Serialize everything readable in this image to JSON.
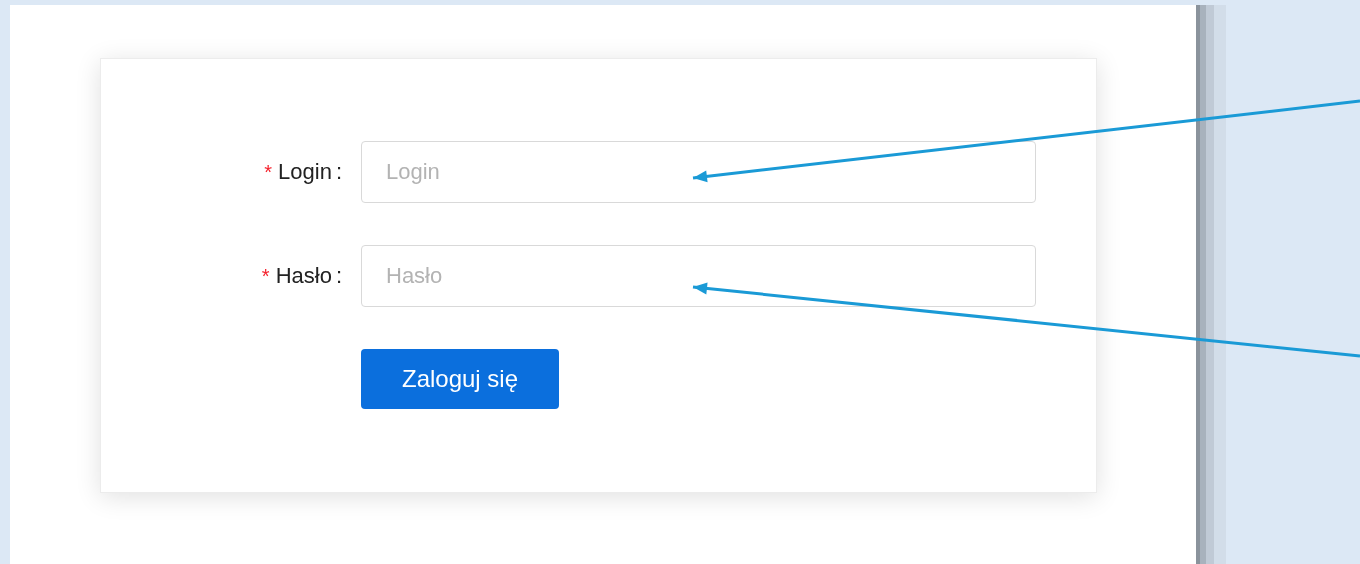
{
  "login_form": {
    "fields": [
      {
        "required_mark": "*",
        "label": "Login",
        "separator": ":",
        "placeholder": "Login"
      },
      {
        "required_mark": "*",
        "label": "Hasło",
        "separator": ":",
        "placeholder": "Hasło"
      }
    ],
    "submit_button": "Zaloguj się"
  }
}
